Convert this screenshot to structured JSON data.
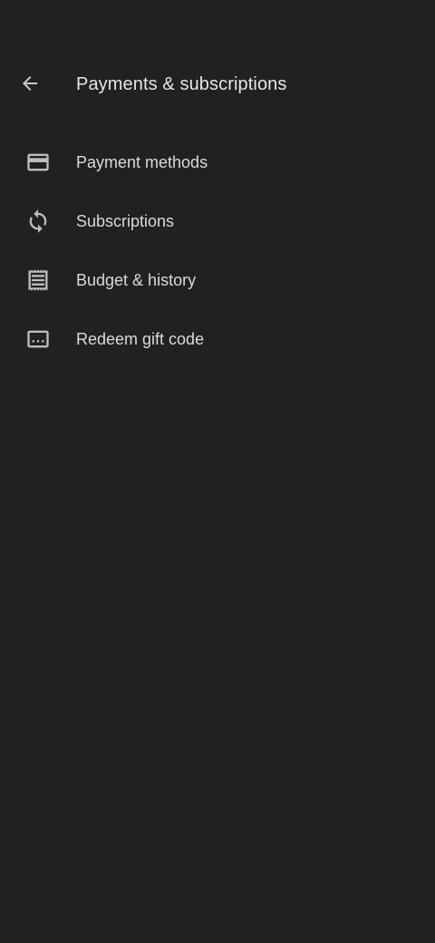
{
  "header": {
    "title": "Payments & subscriptions",
    "back_icon": "arrow-back-icon"
  },
  "menu": {
    "items": [
      {
        "label": "Payment methods",
        "icon": "credit-card-icon"
      },
      {
        "label": "Subscriptions",
        "icon": "sync-icon"
      },
      {
        "label": "Budget & history",
        "icon": "receipt-icon"
      },
      {
        "label": "Redeem gift code",
        "icon": "gift-code-icon"
      }
    ]
  },
  "colors": {
    "background": "#212121",
    "text": "#e3e3e3",
    "icon": "#bdbdbd"
  }
}
